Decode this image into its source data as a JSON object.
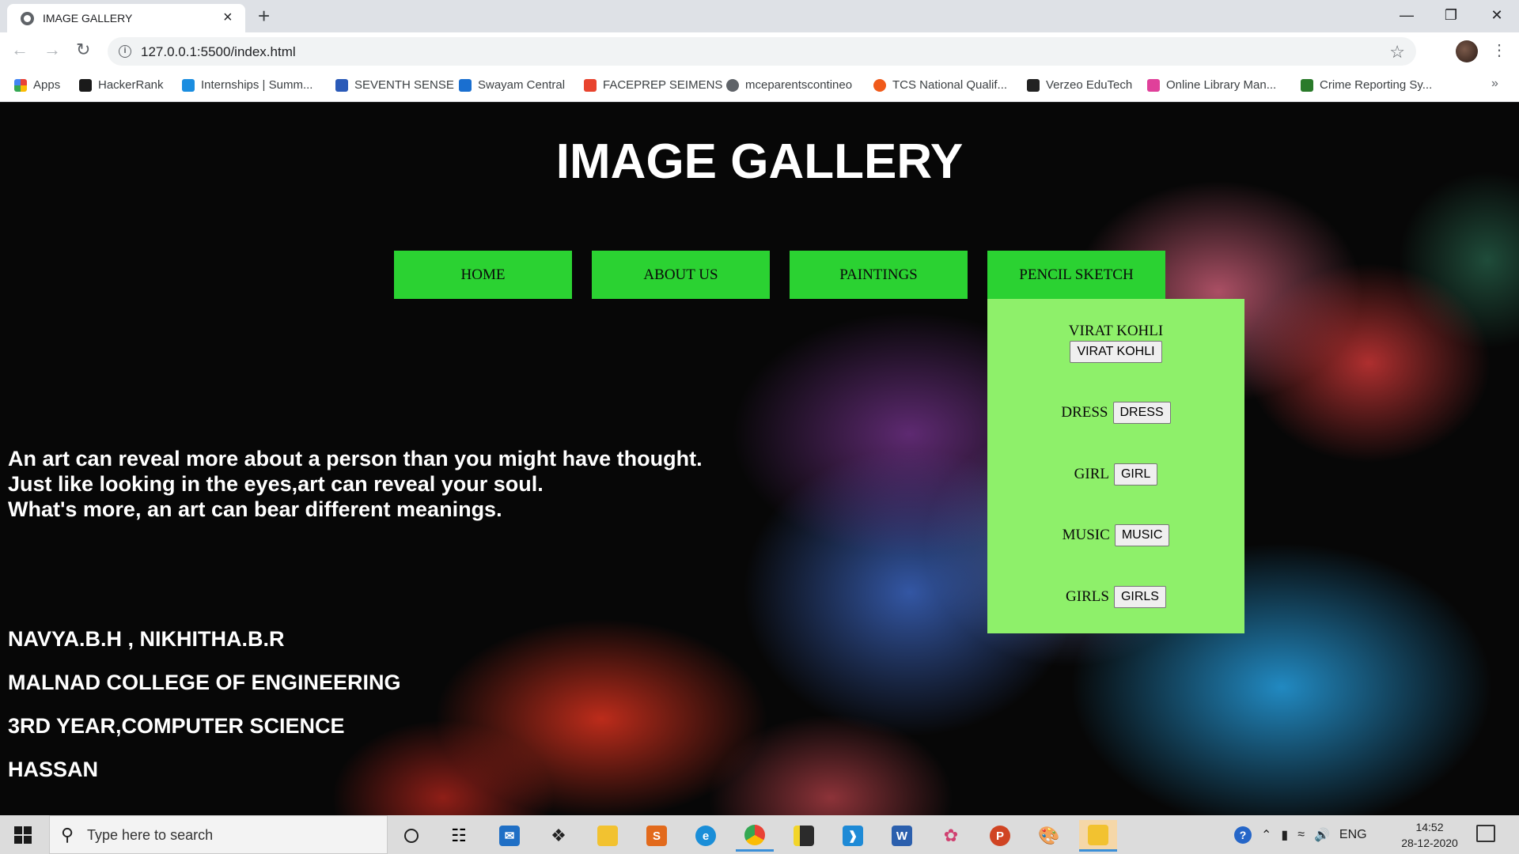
{
  "browser": {
    "tab_title": "IMAGE GALLERY",
    "url": "127.0.0.1:5500/index.html",
    "bookmarks": [
      {
        "label": "Apps",
        "icon": "apps-grid-icon",
        "color": "#e94235"
      },
      {
        "label": "HackerRank",
        "icon": "hackerrank-icon",
        "color": "#1a1a1a"
      },
      {
        "label": "Internships | Summ...",
        "icon": "internshala-icon",
        "color": "#1a8de0"
      },
      {
        "label": "SEVENTH SENSE",
        "icon": "seventh-sense-icon",
        "color": "#2a5ab8"
      },
      {
        "label": "Swayam Central",
        "icon": "swayam-icon",
        "color": "#1a6fd0"
      },
      {
        "label": "FACEPREP SEIMENS",
        "icon": "faceprep-icon",
        "color": "#e8432e"
      },
      {
        "label": "mceparentscontineo",
        "icon": "globe-icon",
        "color": "#5f6368"
      },
      {
        "label": "TCS National Qualif...",
        "icon": "tcs-icon",
        "color": "#f05a1a"
      },
      {
        "label": "Verzeo EduTech",
        "icon": "verzeo-icon",
        "color": "#222222"
      },
      {
        "label": "Online Library Man...",
        "icon": "library-icon",
        "color": "#e0409a"
      },
      {
        "label": "Crime Reporting Sy...",
        "icon": "crime-reporting-icon",
        "color": "#2a7a2a"
      }
    ]
  },
  "page": {
    "title": "IMAGE GALLERY",
    "nav": [
      "HOME",
      "ABOUT US",
      "PAINTINGS",
      "PENCIL SKETCH"
    ],
    "dropdown": [
      {
        "label": "VIRAT KOHLI",
        "button": "VIRAT KOHLI"
      },
      {
        "label": "DRESS",
        "button": "DRESS"
      },
      {
        "label": "GIRL",
        "button": "GIRL"
      },
      {
        "label": "MUSIC",
        "button": "MUSIC"
      },
      {
        "label": "GIRLS",
        "button": "GIRLS"
      }
    ],
    "quote": [
      "An art can reveal more about a person than you might have thought.",
      "Just like looking in the eyes,art can reveal your soul.",
      "What's more, an art can bear different meanings."
    ],
    "info": [
      "NAVYA.B.H , NIKHITHA.B.R",
      "MALNAD COLLEGE OF ENGINEERING",
      "3RD YEAR,COMPUTER SCIENCE",
      "HASSAN"
    ],
    "colors": {
      "nav_button": "#2bd232",
      "dropdown": "#8ef06a"
    }
  },
  "taskbar": {
    "search_placeholder": "Type here to search",
    "language": "ENG",
    "time": "14:52",
    "date": "28-12-2020"
  }
}
